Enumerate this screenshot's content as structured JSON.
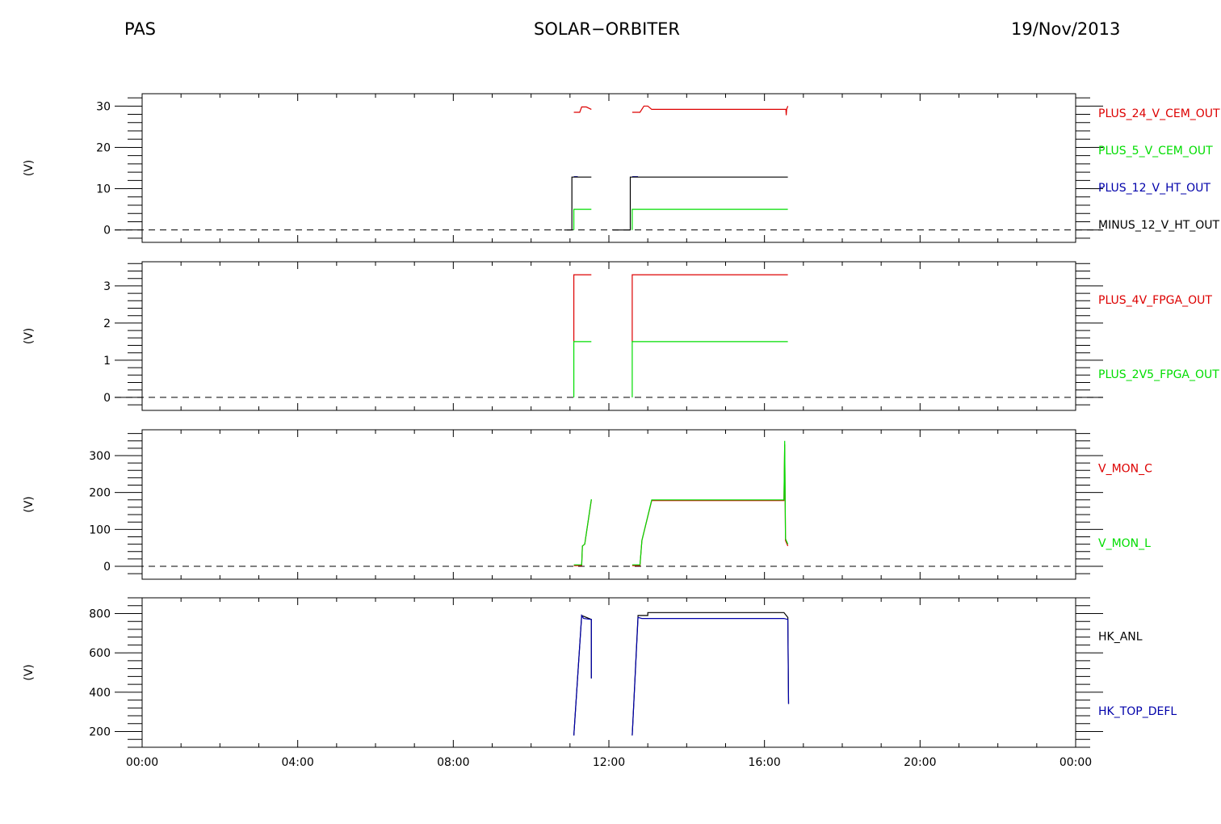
{
  "header": {
    "left": "PAS",
    "center": "SOLAR−ORBITER",
    "right": "19/Nov/2013"
  },
  "colors": {
    "red": "#dd0000",
    "green": "#00dd00",
    "blue": "#0000aa",
    "black": "#000000"
  },
  "chart_data": [
    {
      "type": "line",
      "ylabel": "(V)",
      "ylim": [
        -3,
        33
      ],
      "yticks": [
        0,
        10,
        20,
        30
      ],
      "xlim": [
        0,
        24
      ],
      "xticks": [
        "00:00",
        "04:00",
        "08:00",
        "12:00",
        "16:00",
        "20:00",
        "00:00"
      ],
      "zero_line": true,
      "series": [
        {
          "name": "PLUS_24_V_CEM_OUT",
          "color": "#dd0000",
          "segments": [
            [
              [
                11.1,
                28.5
              ],
              [
                11.25,
                28.5
              ],
              [
                11.3,
                29.8
              ],
              [
                11.42,
                29.8
              ],
              [
                11.55,
                29.2
              ]
            ],
            [
              [
                12.6,
                28.5
              ],
              [
                12.8,
                28.5
              ],
              [
                12.9,
                30.0
              ],
              [
                13.0,
                30.0
              ],
              [
                13.1,
                29.2
              ],
              [
                16.55,
                29.2
              ],
              [
                16.56,
                27.8
              ],
              [
                16.57,
                29.2
              ],
              [
                16.6,
                30.0
              ]
            ]
          ]
        },
        {
          "name": "PLUS_5_V_CEM_OUT",
          "color": "#00dd00",
          "segments": [
            [
              [
                11.1,
                0
              ],
              [
                11.1,
                5.0
              ],
              [
                11.55,
                5.0
              ]
            ],
            [
              [
                12.6,
                0
              ],
              [
                12.6,
                5.0
              ],
              [
                16.6,
                5.0
              ]
            ]
          ]
        },
        {
          "name": "PLUS_12_V_HT_OUT",
          "color": "#0000aa",
          "segments": [
            [
              [
                11.1,
                12.9
              ],
              [
                11.2,
                12.9
              ]
            ],
            [
              [
                12.6,
                12.9
              ],
              [
                12.75,
                12.9
              ]
            ]
          ]
        },
        {
          "name": "MINUS_12_V_HT_OUT",
          "color": "#000000",
          "segments": [
            [
              [
                10.85,
                0
              ],
              [
                11.05,
                0
              ],
              [
                11.05,
                12.8
              ],
              [
                11.55,
                12.8
              ]
            ],
            [
              [
                12.1,
                0
              ],
              [
                12.55,
                0
              ],
              [
                12.55,
                12.8
              ],
              [
                16.6,
                12.8
              ]
            ]
          ]
        }
      ]
    },
    {
      "type": "line",
      "ylabel": "(V)",
      "ylim": [
        -0.35,
        3.65
      ],
      "yticks": [
        0,
        1,
        2,
        3
      ],
      "xlim": [
        0,
        24
      ],
      "xticks": [],
      "zero_line": true,
      "series": [
        {
          "name": "PLUS_4V_FPGA_OUT",
          "color": "#dd0000",
          "segments": [
            [
              [
                11.1,
                1.5
              ],
              [
                11.1,
                3.3
              ],
              [
                11.55,
                3.3
              ]
            ],
            [
              [
                12.6,
                1.5
              ],
              [
                12.6,
                3.3
              ],
              [
                16.6,
                3.3
              ]
            ]
          ]
        },
        {
          "name": "PLUS_2V5_FPGA_OUT",
          "color": "#00dd00",
          "segments": [
            [
              [
                11.1,
                0
              ],
              [
                11.1,
                1.5
              ],
              [
                11.55,
                1.5
              ]
            ],
            [
              [
                12.6,
                0
              ],
              [
                12.6,
                1.5
              ],
              [
                16.6,
                1.5
              ]
            ]
          ]
        }
      ]
    },
    {
      "type": "line",
      "ylabel": "(V)",
      "ylim": [
        -35,
        370
      ],
      "yticks": [
        0,
        100,
        200,
        300
      ],
      "xlim": [
        0,
        24
      ],
      "xticks": [],
      "zero_line": true,
      "series": [
        {
          "name": "V_MON_C",
          "color": "#dd0000",
          "segments": [
            [
              [
                11.1,
                2
              ],
              [
                11.3,
                2
              ],
              [
                11.32,
                55
              ],
              [
                11.38,
                60
              ],
              [
                11.55,
                180
              ]
            ],
            [
              [
                12.6,
                2
              ],
              [
                12.8,
                2
              ],
              [
                12.85,
                70
              ],
              [
                13.1,
                178
              ],
              [
                16.5,
                178
              ],
              [
                16.52,
                330
              ],
              [
                16.54,
                70
              ],
              [
                16.6,
                55
              ]
            ]
          ]
        },
        {
          "name": "V_MON_L",
          "color": "#00dd00",
          "segments": [
            [
              [
                11.1,
                4
              ],
              [
                11.3,
                4
              ],
              [
                11.32,
                55
              ],
              [
                11.38,
                60
              ],
              [
                11.55,
                182
              ]
            ],
            [
              [
                12.6,
                4
              ],
              [
                12.8,
                4
              ],
              [
                12.85,
                70
              ],
              [
                13.1,
                180
              ],
              [
                16.5,
                180
              ],
              [
                16.52,
                340
              ],
              [
                16.54,
                75
              ],
              [
                16.6,
                60
              ]
            ]
          ]
        }
      ]
    },
    {
      "type": "line",
      "ylabel": "(V)",
      "ylim": [
        120,
        880
      ],
      "yticks": [
        200,
        400,
        600,
        800
      ],
      "xlim": [
        0,
        24
      ],
      "xticks": [
        "00:00",
        "04:00",
        "08:00",
        "12:00",
        "16:00",
        "20:00",
        "00:00"
      ],
      "zero_line": false,
      "series": [
        {
          "name": "HK_ANL",
          "color": "#000000",
          "segments": [
            [
              [
                11.1,
                180
              ],
              [
                11.3,
                790
              ],
              [
                11.55,
                770
              ],
              [
                11.55,
                470
              ]
            ],
            [
              [
                12.6,
                180
              ],
              [
                12.75,
                790
              ],
              [
                13.0,
                790
              ],
              [
                13.0,
                805
              ],
              [
                16.5,
                805
              ],
              [
                16.6,
                780
              ],
              [
                16.62,
                340
              ]
            ]
          ]
        },
        {
          "name": "HK_TOP_DEFL",
          "color": "#0000aa",
          "segments": [
            [
              [
                11.1,
                180
              ],
              [
                11.3,
                790
              ],
              [
                11.35,
                775
              ],
              [
                11.55,
                770
              ],
              [
                11.55,
                470
              ]
            ],
            [
              [
                12.6,
                180
              ],
              [
                12.75,
                780
              ],
              [
                12.85,
                775
              ],
              [
                16.5,
                775
              ],
              [
                16.6,
                770
              ],
              [
                16.62,
                340
              ]
            ]
          ]
        }
      ]
    }
  ]
}
